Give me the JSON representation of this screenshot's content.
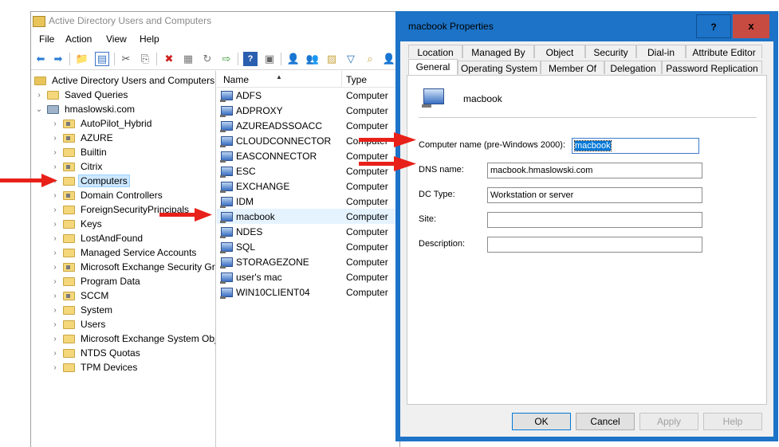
{
  "main_window": {
    "title": "Active Directory Users and Computers",
    "menu": [
      "File",
      "Action",
      "View",
      "Help"
    ]
  },
  "tree": {
    "root": "Active Directory Users and Computers",
    "saved_queries": "Saved Queries",
    "domain": "hmaslowski.com",
    "items": [
      "AutoPilot_Hybrid",
      "AZURE",
      "Builtin",
      "Citrix",
      "Computers",
      "Domain Controllers",
      "ForeignSecurityPrincipals",
      "Keys",
      "LostAndFound",
      "Managed Service Accounts",
      "Microsoft Exchange Security Gr",
      "Program Data",
      "SCCM",
      "System",
      "Users",
      "Microsoft Exchange System Obj",
      "NTDS Quotas",
      "TPM Devices"
    ],
    "selected": "Computers"
  },
  "list": {
    "columns": {
      "name": "Name",
      "type": "Type"
    },
    "rows": [
      {
        "name": "ADFS",
        "type": "Computer"
      },
      {
        "name": "ADPROXY",
        "type": "Computer"
      },
      {
        "name": "AZUREADSSOACC",
        "type": "Computer"
      },
      {
        "name": "CLOUDCONNECTOR",
        "type": "Computer"
      },
      {
        "name": "EASCONNECTOR",
        "type": "Computer"
      },
      {
        "name": "ESC",
        "type": "Computer"
      },
      {
        "name": "EXCHANGE",
        "type": "Computer"
      },
      {
        "name": "IDM",
        "type": "Computer"
      },
      {
        "name": "macbook",
        "type": "Computer"
      },
      {
        "name": "NDES",
        "type": "Computer"
      },
      {
        "name": "SQL",
        "type": "Computer"
      },
      {
        "name": "STORAGEZONE",
        "type": "Computer"
      },
      {
        "name": "user's mac",
        "type": "Computer"
      },
      {
        "name": "WIN10CLIENT04",
        "type": "Computer"
      }
    ]
  },
  "dialog": {
    "title": "macbook Properties",
    "help": "?",
    "close": "x",
    "tabs_row1": [
      "Location",
      "Managed By",
      "Object",
      "Security",
      "Dial-in",
      "Attribute Editor"
    ],
    "tabs_row2": [
      "General",
      "Operating System",
      "Member Of",
      "Delegation",
      "Password Replication"
    ],
    "object_name": "macbook",
    "fields": {
      "computer_name_label": "Computer name (pre-Windows 2000):",
      "computer_name_value": "macbook",
      "dns_label": "DNS name:",
      "dns_value": "macbook.hmaslowski.com",
      "dc_type_label": "DC Type:",
      "dc_type_value": "Workstation or server",
      "site_label": "Site:",
      "site_value": "",
      "description_label": "Description:",
      "description_value": ""
    },
    "buttons": {
      "ok": "OK",
      "cancel": "Cancel",
      "apply": "Apply",
      "help": "Help"
    }
  },
  "colors": {
    "arrow": "#e8201a",
    "dialog_title": "#1c73c7",
    "close": "#c84b42"
  }
}
